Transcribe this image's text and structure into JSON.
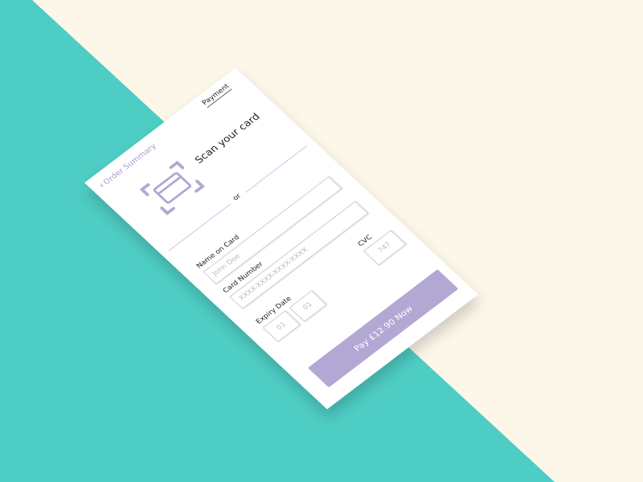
{
  "header": {
    "back_label": "Order Summary",
    "active_tab": "Payment"
  },
  "scan": {
    "label": "Scan your card",
    "icon": "card-scan-icon"
  },
  "divider_text": "or",
  "fields": {
    "name": {
      "label": "Name on Card",
      "placeholder": "John Doe"
    },
    "card_number": {
      "label": "Card Number",
      "placeholder": "XXXX-XXXX-XXXX-XXXX"
    },
    "expiry": {
      "label": "Expiry Date",
      "month": "01",
      "year": "01"
    },
    "cvc": {
      "label": "CVC",
      "placeholder": "747"
    }
  },
  "pay_button": "Pay £12.90 Now",
  "colors": {
    "accent": "#b3a7d3",
    "teal": "#4ecdc4",
    "cream": "#fdf7ea"
  }
}
